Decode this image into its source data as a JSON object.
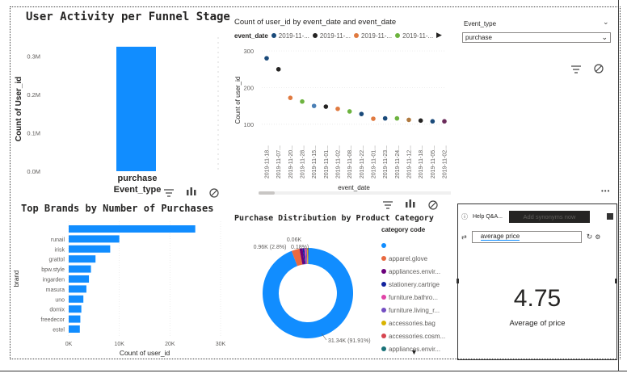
{
  "funnel": {
    "title": "User Activity per Funnel Stage",
    "ylabel": "Count of User_id",
    "xlabel": "Event_type",
    "yticks": [
      "0.3M",
      "0.2M",
      "0.1M",
      "0.0M"
    ]
  },
  "timeline": {
    "title": "Count of user_id by event_date and event_date",
    "legend_title": "event_date",
    "legend_items": [
      "2019-11-...",
      "2019-11-...",
      "2019-11-...",
      "2019-11-..."
    ],
    "legend_colors": [
      "#1a4a7a",
      "#252423",
      "#e07a40",
      "#6db33f"
    ],
    "ylabel": "Count of user_id",
    "xlabel": "event_date",
    "yticks": [
      "300",
      "200",
      "100"
    ]
  },
  "slicer": {
    "title": "Event_type",
    "value": "purchase"
  },
  "brands": {
    "title": "Top Brands by Number of Purchases",
    "ylabel": "brand",
    "xlabel": "Count of user_id",
    "xticks": [
      "0K",
      "10K",
      "20K",
      "30K"
    ]
  },
  "category": {
    "title": "Purchase Distribution by Product Category",
    "legend_title": "category code",
    "legend_items": [
      {
        "label": "",
        "color": "#118dff"
      },
      {
        "label": "apparel.glove",
        "color": "#e8693f"
      },
      {
        "label": "appliances.envir...",
        "color": "#6b007b"
      },
      {
        "label": "stationery.cartrige",
        "color": "#12239e"
      },
      {
        "label": "furniture.bathro...",
        "color": "#e044a7"
      },
      {
        "label": "furniture.living_r...",
        "color": "#744ec2"
      },
      {
        "label": "accessories.bag",
        "color": "#d9b300"
      },
      {
        "label": "accessories.cosm...",
        "color": "#d64550"
      },
      {
        "label": "appliances.envir...",
        "color": "#197278"
      }
    ],
    "labels": {
      "small": "0.06K",
      "mid": "0.96K (2.8%)",
      "mid2": "0.18%)",
      "big": "31.34K (91.91%)"
    }
  },
  "qa": {
    "help": "Help Q&A...",
    "synonyms_button": "Add synonyms now",
    "query": "average price",
    "value": "4.75",
    "value_label": "Average of price"
  },
  "chart_data": [
    {
      "type": "bar",
      "title": "User Activity per Funnel Stage",
      "categories": [
        "purchase"
      ],
      "values": [
        325000
      ],
      "xlabel": "Event_type",
      "ylabel": "Count of User_id",
      "ylim": [
        0,
        350000
      ],
      "grid": false
    },
    {
      "type": "scatter",
      "title": "Count of user_id by event_date and event_date",
      "xlabel": "event_date",
      "ylabel": "Count of user_id",
      "x": [
        "2019-11-18...",
        "2019-11-07...",
        "2019-11-20...",
        "2019-11-28...",
        "2019-11-15...",
        "2019-11-01...",
        "2019-11-02...",
        "2019-11-08...",
        "2019-11-22...",
        "2019-11-01...",
        "2019-11-23...",
        "2019-11-24...",
        "2019-11-12...",
        "2019-11-18...",
        "2019-11-05...",
        "2019-11-02..."
      ],
      "values": [
        280,
        250,
        172,
        162,
        150,
        148,
        142,
        135,
        128,
        115,
        116,
        116,
        112,
        110,
        108,
        108
      ],
      "point_colors": [
        "#1a4a7a",
        "#252423",
        "#e07a40",
        "#6db33f",
        "#4a7fb5",
        "#252423",
        "#e07a40",
        "#6db33f",
        "#1a4a7a",
        "#e07a40",
        "#1a4a7a",
        "#6db33f",
        "#b07a40",
        "#252423",
        "#1a4a7a",
        "#6b2a5a"
      ],
      "ylim": [
        60,
        320
      ],
      "grid": true
    },
    {
      "type": "bar",
      "title": "Top Brands by Number of Purchases",
      "orientation": "horizontal",
      "categories": [
        "",
        "runail",
        "irisk",
        "grattol",
        "bpw.style",
        "ingarden",
        "masura",
        "uno",
        "domix",
        "freedecor",
        "estel"
      ],
      "values": [
        25000,
        10000,
        8200,
        5300,
        4400,
        4000,
        3500,
        2900,
        2500,
        2300,
        2200
      ],
      "xlabel": "Count of user_id",
      "ylabel": "brand",
      "xlim": [
        0,
        30000
      ]
    },
    {
      "type": "pie",
      "donut": true,
      "title": "Purchase Distribution by Product Category",
      "categories": [
        "",
        "apparel.glove",
        "appliances.envir...",
        "stationery.cartrige",
        "furniture.bathro...",
        "furniture.living_r...",
        "accessories.bag",
        "accessories.cosm...",
        "appliances.envir..."
      ],
      "values": [
        31340,
        960,
        380,
        200,
        180,
        120,
        90,
        70,
        60
      ]
    }
  ]
}
